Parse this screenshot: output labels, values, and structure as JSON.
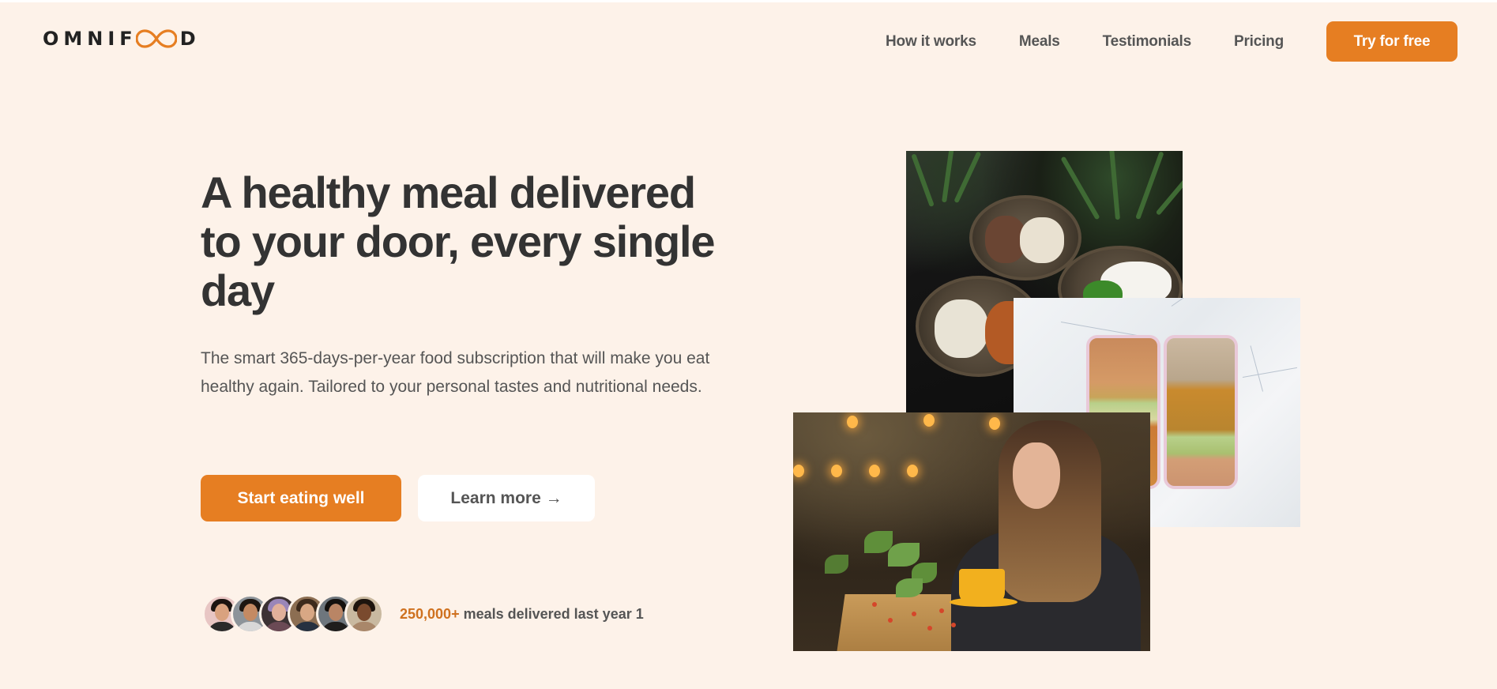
{
  "header": {
    "logo": {
      "before": "OMNIF",
      "after": "D",
      "symbol": "infinity-icon"
    },
    "nav": [
      {
        "label": "How it works"
      },
      {
        "label": "Meals"
      },
      {
        "label": "Testimonials"
      },
      {
        "label": "Pricing"
      }
    ],
    "cta_label": "Try for free"
  },
  "hero": {
    "title": "A healthy meal delivered to your door, every single day",
    "description": "The smart 365-days-per-year food subscription that will make you eat healthy again. Tailored to your personal tastes and nutritional needs.",
    "primary_button": "Start eating well",
    "secondary_button": "Learn more →",
    "delivered": {
      "count": "250,000+",
      "text": " meals delivered last year 1",
      "avatars": [
        {
          "name": "customer-1"
        },
        {
          "name": "customer-2"
        },
        {
          "name": "customer-3"
        },
        {
          "name": "customer-4"
        },
        {
          "name": "customer-5"
        },
        {
          "name": "customer-6"
        }
      ]
    },
    "images": [
      {
        "name": "bowls-of-food-image",
        "alt": "Bowls of meat, rice and vegetables on a dark table"
      },
      {
        "name": "bento-boxes-image",
        "alt": "Meal prep boxes with chickpeas, avocado and curry on marble"
      },
      {
        "name": "woman-eating-image",
        "alt": "Woman enjoying a meal in a cafe"
      }
    ]
  },
  "colors": {
    "background": "#fdf2e9",
    "accent": "#e67e22",
    "accent_text": "#cf711f",
    "heading": "#333333",
    "body_text": "#555555"
  }
}
